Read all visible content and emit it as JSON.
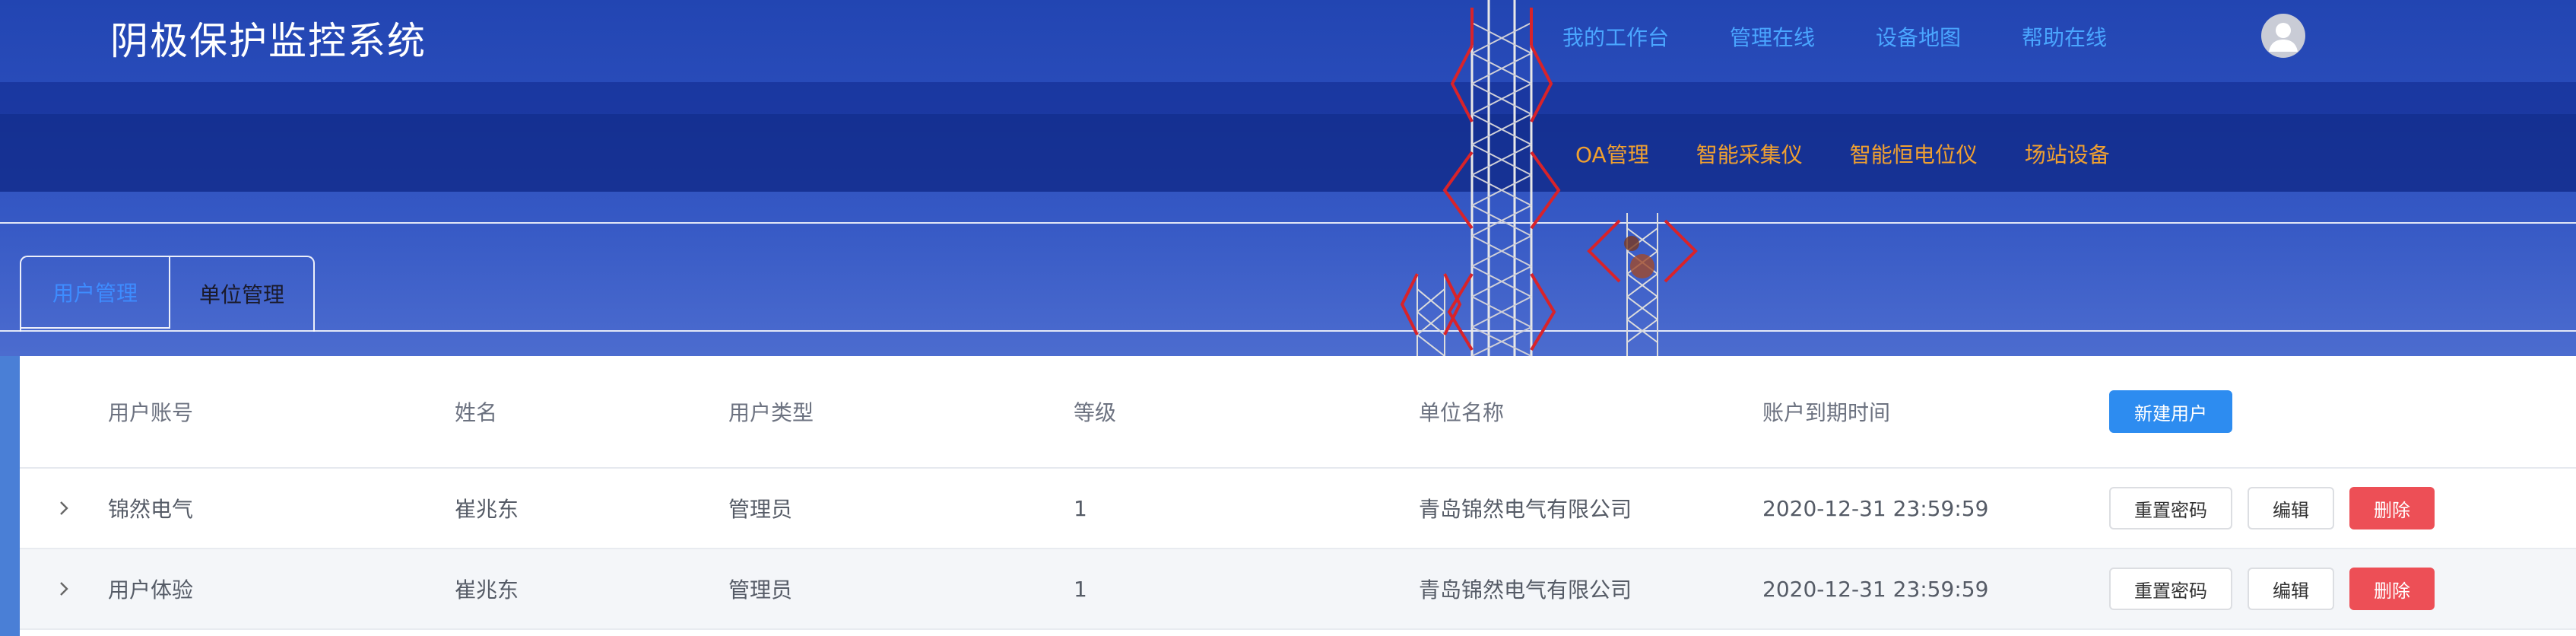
{
  "header": {
    "app_title": "阴极保护监控系统",
    "top_nav": [
      "我的工作台",
      "管理在线",
      "设备地图",
      "帮助在线"
    ],
    "sub_nav": [
      "OA管理",
      "智能采集仪",
      "智能恒电位仪",
      "场站设备"
    ]
  },
  "tabs": {
    "user_management": "用户管理",
    "unit_management": "单位管理"
  },
  "table": {
    "columns": {
      "account": "用户账号",
      "name": "姓名",
      "user_type": "用户类型",
      "level": "等级",
      "unit": "单位名称",
      "expiry": "账户到期时间"
    },
    "new_user_label": "新建用户",
    "rows": [
      {
        "account": "锦然电气",
        "name": "崔兆东",
        "user_type": "管理员",
        "level": "1",
        "unit": "青岛锦然电气有限公司",
        "expiry": "2020-12-31 23:59:59"
      },
      {
        "account": "用户体验",
        "name": "崔兆东",
        "user_type": "管理员",
        "level": "1",
        "unit": "青岛锦然电气有限公司",
        "expiry": "2020-12-31 23:59:59"
      }
    ],
    "actions": {
      "reset_password": "重置密码",
      "edit": "编辑",
      "delete": "删除"
    }
  },
  "colors": {
    "accent": "#2d8cf0",
    "nav_link": "#4aa6ff",
    "sub_nav_link": "#f0a030",
    "danger": "#ed4f56"
  }
}
